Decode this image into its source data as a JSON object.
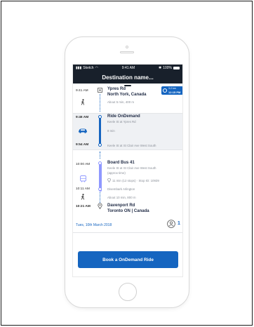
{
  "status_bar": {
    "carrier": "Sketch",
    "time": "9:41 AM",
    "battery": "100%"
  },
  "header": {
    "title": "Destination name..."
  },
  "trip": {
    "badge": {
      "line1": "3.2 km",
      "line2": "12:15 PM"
    },
    "origin": {
      "time": "9:41 AM",
      "name": "Ypres Rd",
      "city": "North York, Canada",
      "walk": "About 5 min, 400 m"
    },
    "ride": {
      "start_time": "9:46 AM",
      "title": "Ride OnDemand",
      "pickup": "Keele St at Ypres Rd",
      "duration": "8 min",
      "end_time": "9:54 AM",
      "dropoff": "Keele St at St Clair Ave West South"
    },
    "bus": {
      "time": "10:00 AM",
      "title": "Board Bus 41",
      "stop": "Keele St at St Clair Ave West South",
      "approx": "(approx time)",
      "info": "11 min (12 stops) · Stop ID: 10939",
      "disembark_time": "10:11 AM",
      "disembark": "Disembark Arlington"
    },
    "walk2": {
      "text": "About 10 min, 800 m"
    },
    "destination": {
      "time": "10:21 AM",
      "name": "Davenport Rd",
      "city": "Toronto ON | Canada"
    }
  },
  "footer": {
    "date": "Tues, 10th March 2018",
    "passengers": "1",
    "book_label": "Book a OnDemand Ride"
  },
  "colors": {
    "primary": "#1565c0",
    "header_bg": "#18202b",
    "bus_line": "#8f98ff"
  }
}
